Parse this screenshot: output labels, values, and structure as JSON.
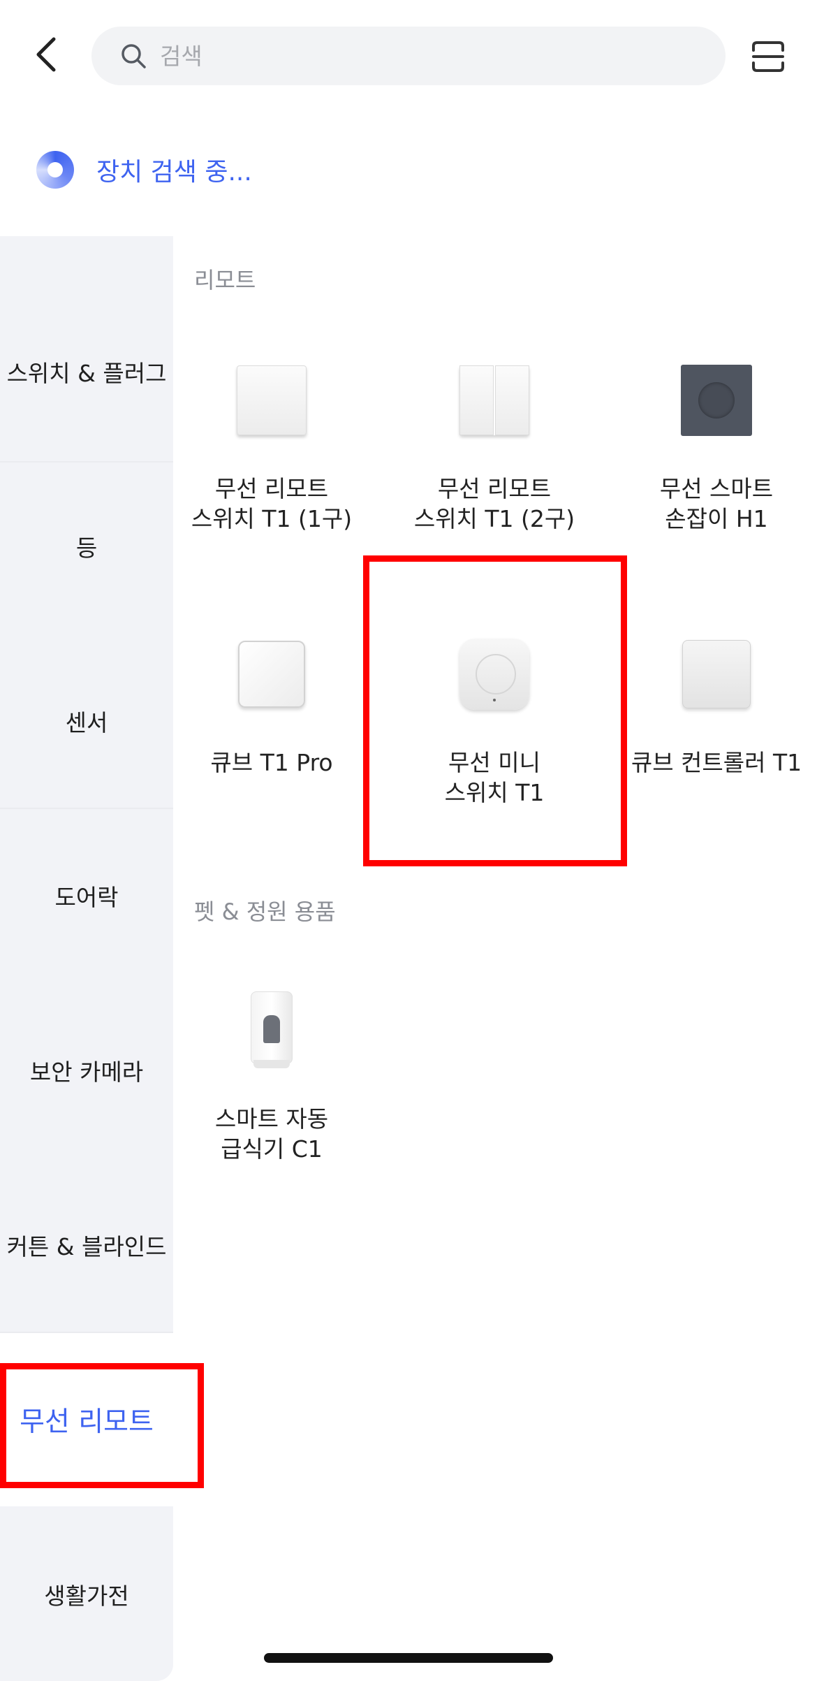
{
  "header": {
    "back_icon": "chevron-left-icon",
    "search_placeholder": "검색",
    "search_icon": "search-icon",
    "scan_icon": "scan-icon"
  },
  "status": {
    "text": "장치 검색 중...",
    "accent_color": "#3e63f0"
  },
  "sidebar": {
    "items": [
      {
        "label": "스위치 & 플러그"
      },
      {
        "label": "등"
      },
      {
        "label": "센서"
      },
      {
        "label": "도어락"
      },
      {
        "label": "보안 카메라"
      },
      {
        "label": "커튼 & 블라인드"
      },
      {
        "label": "무선 리모트",
        "active": true
      },
      {
        "label": "생활가전"
      }
    ]
  },
  "sections": [
    {
      "title": "리모트",
      "devices": [
        {
          "line1": "무선 리모트",
          "line2": "스위치 T1 (1구)"
        },
        {
          "line1": "무선 리모트",
          "line2": "스위치 T1 (2구)"
        },
        {
          "line1": "무선 스마트",
          "line2": "손잡이 H1"
        },
        {
          "line1": "큐브 T1 Pro",
          "line2": ""
        },
        {
          "line1": "무선 미니",
          "line2": "스위치 T1",
          "highlighted": true
        },
        {
          "line1": "큐브 컨트롤러 T1",
          "line2": ""
        }
      ]
    },
    {
      "title": "펫 & 정원 용품",
      "devices": [
        {
          "line1": "스마트 자동",
          "line2": "급식기 C1"
        }
      ]
    }
  ],
  "highlight_color": "#ff0000"
}
